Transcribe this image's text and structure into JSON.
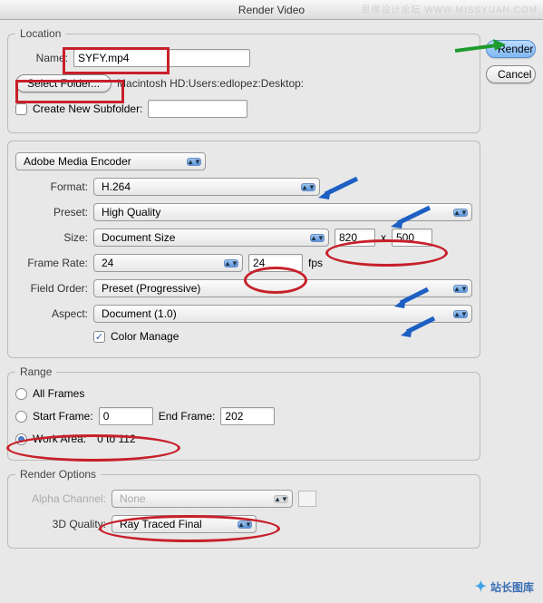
{
  "title": "Render Video",
  "buttons": {
    "render": "Render",
    "cancel": "Cancel",
    "selectFolder": "Select Folder..."
  },
  "location": {
    "legend": "Location",
    "nameLabel": "Name:",
    "nameValue": "SYFY.mp4",
    "path": "Macintosh HD:Users:edlopez:Desktop:",
    "subfolderLabel": "Create New Subfolder:",
    "subfolderValue": ""
  },
  "encoder": {
    "encoderName": "Adobe Media Encoder",
    "formatLabel": "Format:",
    "formatValue": "H.264",
    "presetLabel": "Preset:",
    "presetValue": "High Quality",
    "sizeLabel": "Size:",
    "sizeMode": "Document Size",
    "width": "820",
    "height": "500",
    "x": "x",
    "frameRateLabel": "Frame Rate:",
    "frameRateMode": "24",
    "frameRateValue": "24",
    "fps": "fps",
    "fieldOrderLabel": "Field Order:",
    "fieldOrderValue": "Preset (Progressive)",
    "aspectLabel": "Aspect:",
    "aspectValue": "Document (1.0)",
    "colorManage": "Color Manage"
  },
  "range": {
    "legend": "Range",
    "allFrames": "All Frames",
    "startFrameLabel": "Start Frame:",
    "startFrameValue": "0",
    "endFrameLabel": "End Frame:",
    "endFrameValue": "202",
    "workAreaLabel": "Work Area:",
    "workAreaText": "0 to 112"
  },
  "renderOptions": {
    "legend": "Render Options",
    "alphaLabel": "Alpha Channel:",
    "alphaValue": "None",
    "qualityLabel": "3D Quality:",
    "qualityValue": "Ray Traced Final"
  },
  "watermarks": {
    "top": "思缘设计论坛 WWW.MISSYUAN.COM",
    "bottom": "站长图库"
  }
}
